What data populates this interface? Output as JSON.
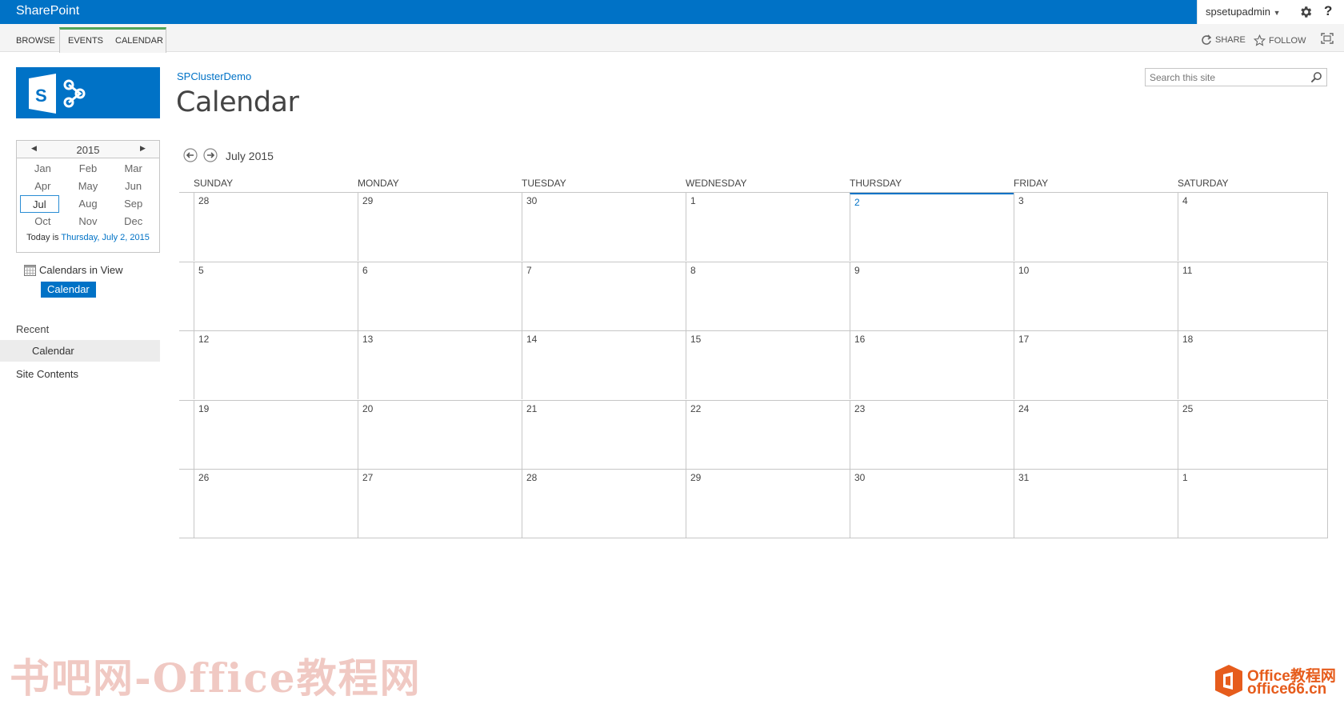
{
  "suite": {
    "brand": "SharePoint",
    "user": "spsetupadmin",
    "help": "?"
  },
  "ribbon": {
    "tabs": [
      "BROWSE",
      "EVENTS",
      "CALENDAR"
    ],
    "share": "SHARE",
    "follow": "FOLLOW"
  },
  "header": {
    "breadcrumb": "SPClusterDemo",
    "title": "Calendar",
    "search_placeholder": "Search this site"
  },
  "picker": {
    "year": "2015",
    "months": [
      "Jan",
      "Feb",
      "Mar",
      "Apr",
      "May",
      "Jun",
      "Jul",
      "Aug",
      "Sep",
      "Oct",
      "Nov",
      "Dec"
    ],
    "selected_month": "Jul",
    "today_prefix": "Today is",
    "today_date": "Thursday, July 2, 2015"
  },
  "calendars_in_view": {
    "label": "Calendars in View",
    "tag": "Calendar"
  },
  "nav": {
    "recent": "Recent",
    "recent_item": "Calendar",
    "site_contents": "Site Contents"
  },
  "calendar": {
    "month_label": "July 2015",
    "days": [
      "SUNDAY",
      "MONDAY",
      "TUESDAY",
      "WEDNESDAY",
      "THURSDAY",
      "FRIDAY",
      "SATURDAY"
    ],
    "weeks": [
      [
        "28",
        "29",
        "30",
        "1",
        "2",
        "3",
        "4"
      ],
      [
        "5",
        "6",
        "7",
        "8",
        "9",
        "10",
        "11"
      ],
      [
        "12",
        "13",
        "14",
        "15",
        "16",
        "17",
        "18"
      ],
      [
        "19",
        "20",
        "21",
        "22",
        "23",
        "24",
        "25"
      ],
      [
        "26",
        "27",
        "28",
        "29",
        "30",
        "31",
        "1"
      ]
    ],
    "today": "2"
  },
  "watermark": {
    "left": "书吧网-Office教程网",
    "right_line1": "Office教程网",
    "right_line2": "office66.cn"
  },
  "colors": {
    "brand_blue": "#0072c6",
    "ribbon_accent": "#50a55a"
  }
}
